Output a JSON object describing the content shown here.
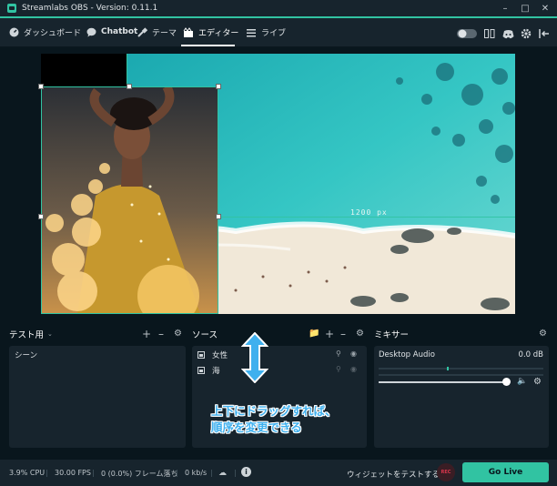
{
  "app": {
    "title": "Streamlabs OBS - Version: 0.11.1",
    "accent_color": "#31c3a2",
    "bg_color": "#09161d",
    "panel_color": "#17242d"
  },
  "window_controls": {
    "minimize_icon": "minimize-icon",
    "maximize_icon": "maximize-icon",
    "close_icon": "close-icon"
  },
  "nav": {
    "items": [
      {
        "label": "ダッシュボード",
        "icon": "dashboard-icon"
      },
      {
        "label": "Chatbot",
        "icon": "chat-bubble-icon"
      },
      {
        "label": "テーマ",
        "icon": "paint-icon"
      },
      {
        "label": "エディター",
        "icon": "editor-icon",
        "active": true
      },
      {
        "label": "ライブ",
        "icon": "live-icon"
      }
    ],
    "right_icons": [
      "theme-toggle-icon",
      "studio-mode-icon",
      "discord-icon",
      "settings-icon",
      "logout-icon"
    ]
  },
  "preview": {
    "distance_label": "1200 px",
    "sources_shown": [
      "beach-image",
      "woman-image"
    ]
  },
  "scenes_panel": {
    "title": "テスト用",
    "dropdown_icon": "chevron-down-icon",
    "items": [
      "シーン"
    ]
  },
  "sources_panel": {
    "title": "ソース",
    "items": [
      {
        "label": "女性",
        "icon": "image-icon"
      },
      {
        "label": "海",
        "icon": "image-icon"
      }
    ]
  },
  "mixer_panel": {
    "title": "ミキサー",
    "channel": "Desktop Audio",
    "level": "0.0 dB",
    "volume_fraction": 1.0
  },
  "annotation": {
    "line1": "上下にドラッグすれば、",
    "line2": "順序を変更できる"
  },
  "footer": {
    "cpu": "3.9% CPU",
    "fps": "30.00 FPS",
    "dropped": "0 (0.0%) フレーム落ち",
    "bandwidth": "0 kb/s",
    "test_widgets": "ウィジェットをテストする",
    "rec_label": "REC",
    "go_live": "Go Live"
  }
}
